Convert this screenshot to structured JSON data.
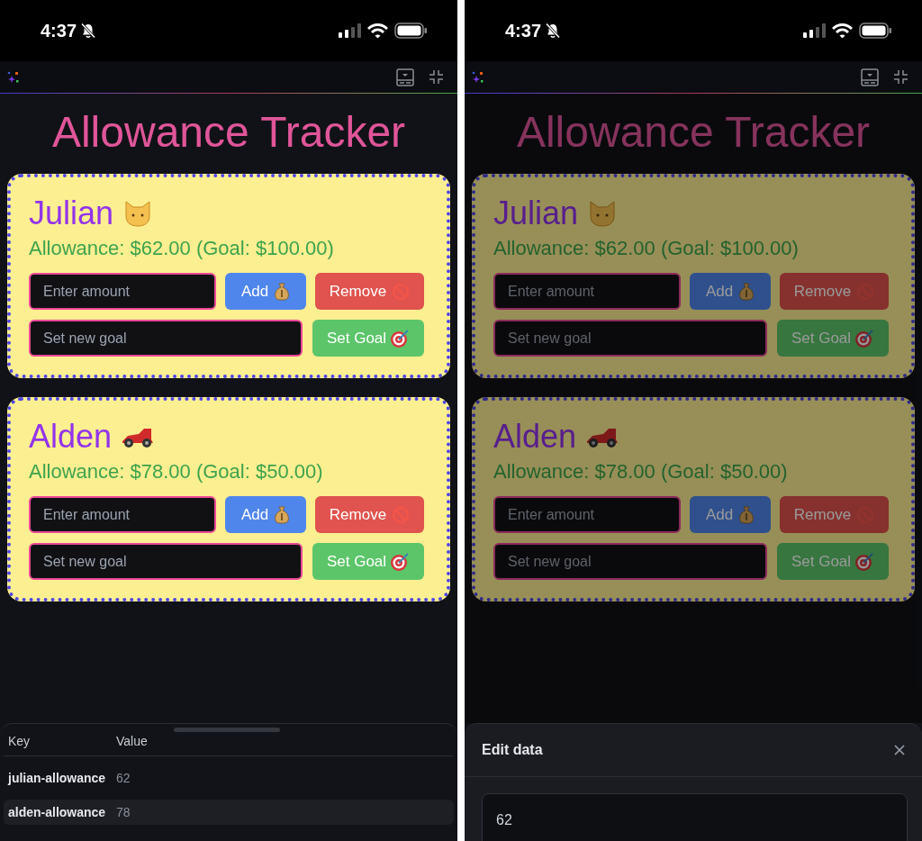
{
  "screens": [
    {
      "status_bar": {
        "time": "4:37"
      },
      "dimmed": false,
      "app": {
        "title": "Allowance Tracker",
        "kids": [
          {
            "name": "Julian",
            "kind": "cat",
            "allowance_text": "Allowance: $62.00 (Goal: $100.00)",
            "amount_placeholder": "Enter amount",
            "add_button": "Add",
            "remove_button": "Remove",
            "goal_placeholder": "Set new goal",
            "goal_button": "Set Goal"
          },
          {
            "name": "Alden",
            "kind": "race-car",
            "allowance_text": "Allowance: $78.00 (Goal: $50.00)",
            "amount_placeholder": "Enter amount",
            "add_button": "Add",
            "remove_button": "Remove",
            "goal_placeholder": "Set new goal",
            "goal_button": "Set Goal"
          }
        ]
      },
      "sheet": {
        "kind": "table",
        "columns": [
          "Key",
          "Value"
        ],
        "rows": [
          {
            "key": "julian-allowance",
            "value": "62",
            "selected": false
          },
          {
            "key": "alden-allowance",
            "value": "78",
            "selected": true
          }
        ]
      }
    },
    {
      "status_bar": {
        "time": "4:37"
      },
      "dimmed": true,
      "app": {
        "title": "Allowance Tracker",
        "kids": [
          {
            "name": "Julian",
            "kind": "cat",
            "allowance_text": "Allowance: $62.00 (Goal: $100.00)",
            "amount_placeholder": "Enter amount",
            "add_button": "Add",
            "remove_button": "Remove",
            "goal_placeholder": "Set new goal",
            "goal_button": "Set Goal"
          },
          {
            "name": "Alden",
            "kind": "race-car",
            "allowance_text": "Allowance: $78.00 (Goal: $50.00)",
            "amount_placeholder": "Enter amount",
            "add_button": "Add",
            "remove_button": "Remove",
            "goal_placeholder": "Set new goal",
            "goal_button": "Set Goal"
          }
        ]
      },
      "sheet": {
        "kind": "editor",
        "title": "Edit data",
        "value": "62"
      }
    }
  ]
}
